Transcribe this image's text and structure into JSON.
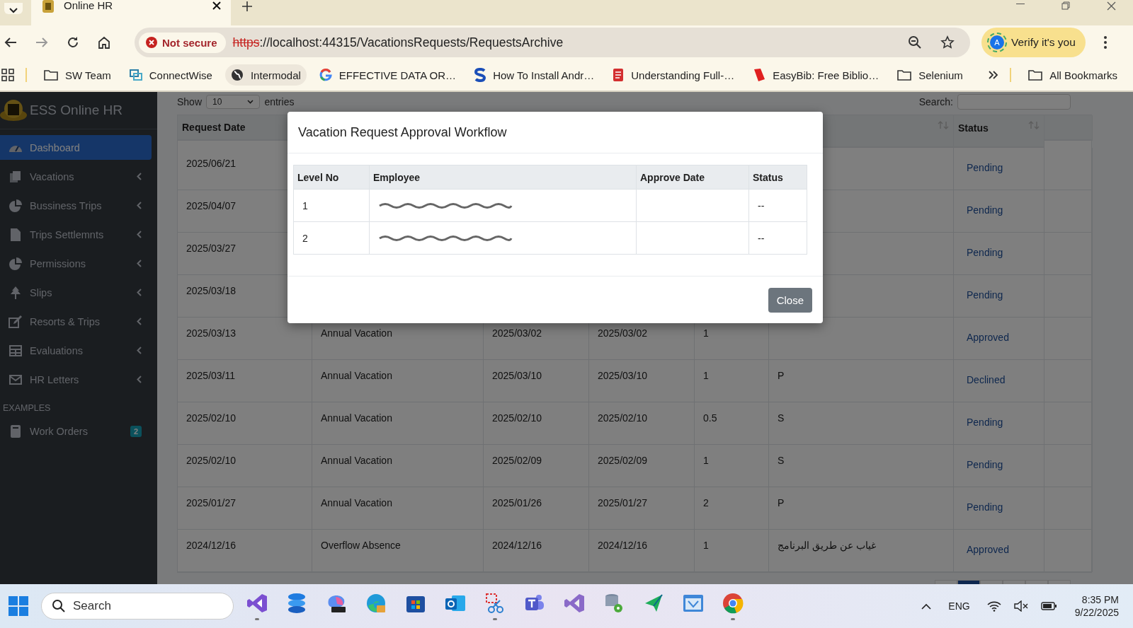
{
  "browser": {
    "tab": {
      "title": "Online HR"
    },
    "security": "Not secure",
    "url_scheme": "https",
    "url_rest": "://localhost:44315/VacationsRequests/RequestsArchive",
    "profile": {
      "initial": "A",
      "label": "Verify it's you"
    },
    "bookmarks": [
      {
        "kind": "folder",
        "label": "SW Team",
        "highlighted": false
      },
      {
        "kind": "connectwise",
        "label": "ConnectWise",
        "highlighted": false
      },
      {
        "kind": "globe",
        "label": "Intermodal",
        "highlighted": true
      },
      {
        "kind": "google",
        "label": "EFFECTIVE DATA OR…",
        "highlighted": false
      },
      {
        "kind": "s",
        "label": "How To Install Andr…",
        "highlighted": false
      },
      {
        "kind": "doc",
        "label": "Understanding Full-…",
        "highlighted": false
      },
      {
        "kind": "book",
        "label": "EasyBib: Free Biblio…",
        "highlighted": false
      },
      {
        "kind": "folder",
        "label": "Selenium",
        "highlighted": false
      }
    ],
    "all_bookmarks": "All Bookmarks"
  },
  "sidebar": {
    "brand": "ESS Online HR",
    "items": [
      {
        "kind": "dashboard",
        "label": "Dashboard",
        "selected": true,
        "expandable": false
      },
      {
        "kind": "copy",
        "label": "Vacations",
        "selected": false,
        "expandable": true
      },
      {
        "kind": "pie",
        "label": "Bussiness Trips",
        "selected": false,
        "expandable": true
      },
      {
        "kind": "file",
        "label": "Trips Settlemnts",
        "selected": false,
        "expandable": true
      },
      {
        "kind": "pie",
        "label": "Permissions",
        "selected": false,
        "expandable": true
      },
      {
        "kind": "tree",
        "label": "Slips",
        "selected": false,
        "expandable": true
      },
      {
        "kind": "edit",
        "label": "Resorts & Trips",
        "selected": false,
        "expandable": true
      },
      {
        "kind": "table",
        "label": "Evaluations",
        "selected": false,
        "expandable": true
      },
      {
        "kind": "mail",
        "label": "HR Letters",
        "selected": false,
        "expandable": true
      }
    ],
    "section": "EXAMPLES",
    "extra": [
      {
        "kind": "book",
        "label": "Work Orders",
        "badge": "2"
      }
    ]
  },
  "page": {
    "show_label": "Show",
    "length": "10",
    "entries_label": "entries",
    "search_label": "Search:",
    "header": {
      "request_date": "Request Date",
      "status": "Status"
    },
    "rows": [
      {
        "request_date": "2025/06/21",
        "status": "Pending"
      },
      {
        "request_date": "2025/04/07",
        "status": "Pending"
      },
      {
        "request_date": "2025/03/27",
        "status": "Pending"
      },
      {
        "request_date": "2025/03/18",
        "status": "Pending"
      },
      {
        "request_date": "2025/03/13",
        "type": "Annual Vacation",
        "from": "2025/03/02",
        "to": "2025/03/02",
        "days": "1",
        "status": "Approved"
      },
      {
        "request_date": "2025/03/11",
        "type": "Annual Vacation",
        "from": "2025/03/10",
        "to": "2025/03/10",
        "days": "1",
        "note": "P",
        "status": "Declined"
      },
      {
        "request_date": "2025/02/10",
        "type": "Annual Vacation",
        "from": "2025/02/10",
        "to": "2025/02/10",
        "days": "0.5",
        "note": "S",
        "status": "Pending"
      },
      {
        "request_date": "2025/02/10",
        "type": "Annual Vacation",
        "from": "2025/02/09",
        "to": "2025/02/09",
        "days": "1",
        "note": "S",
        "status": "Pending"
      },
      {
        "request_date": "2025/01/27",
        "type": "Annual Vacation",
        "from": "2025/01/26",
        "to": "2025/01/27",
        "days": "2",
        "note": "P",
        "status": "Pending"
      },
      {
        "request_date": "2024/12/16",
        "type": "Overflow Absence",
        "from": "2024/12/16",
        "to": "2024/12/16",
        "days": "1",
        "note": "غياب عن طريق البرنامج",
        "status": "Approved"
      }
    ]
  },
  "modal": {
    "title": "Vacation Request Approval Workflow",
    "columns": [
      "Level No",
      "Employee",
      "Approve Date",
      "Status"
    ],
    "rows": [
      {
        "level": "1",
        "status": "--"
      },
      {
        "level": "2",
        "status": "--"
      }
    ],
    "close": "Close"
  },
  "taskbar": {
    "search_placeholder": "Search",
    "apps": [
      {
        "kind": "vs",
        "running": true
      },
      {
        "kind": "stack",
        "running": false
      },
      {
        "kind": "m365",
        "running": false
      },
      {
        "kind": "edge",
        "running": false
      },
      {
        "kind": "store",
        "running": false
      },
      {
        "kind": "outlook",
        "running": false
      },
      {
        "kind": "snip",
        "running": true
      },
      {
        "kind": "teams",
        "running": false
      },
      {
        "kind": "vs2",
        "running": false
      },
      {
        "kind": "dbgear",
        "running": false
      },
      {
        "kind": "arrow",
        "running": false
      },
      {
        "kind": "window",
        "running": false
      },
      {
        "kind": "chrome",
        "running": true
      }
    ],
    "language": "ENG",
    "time": "8:35 PM",
    "date": "9/22/2025"
  }
}
